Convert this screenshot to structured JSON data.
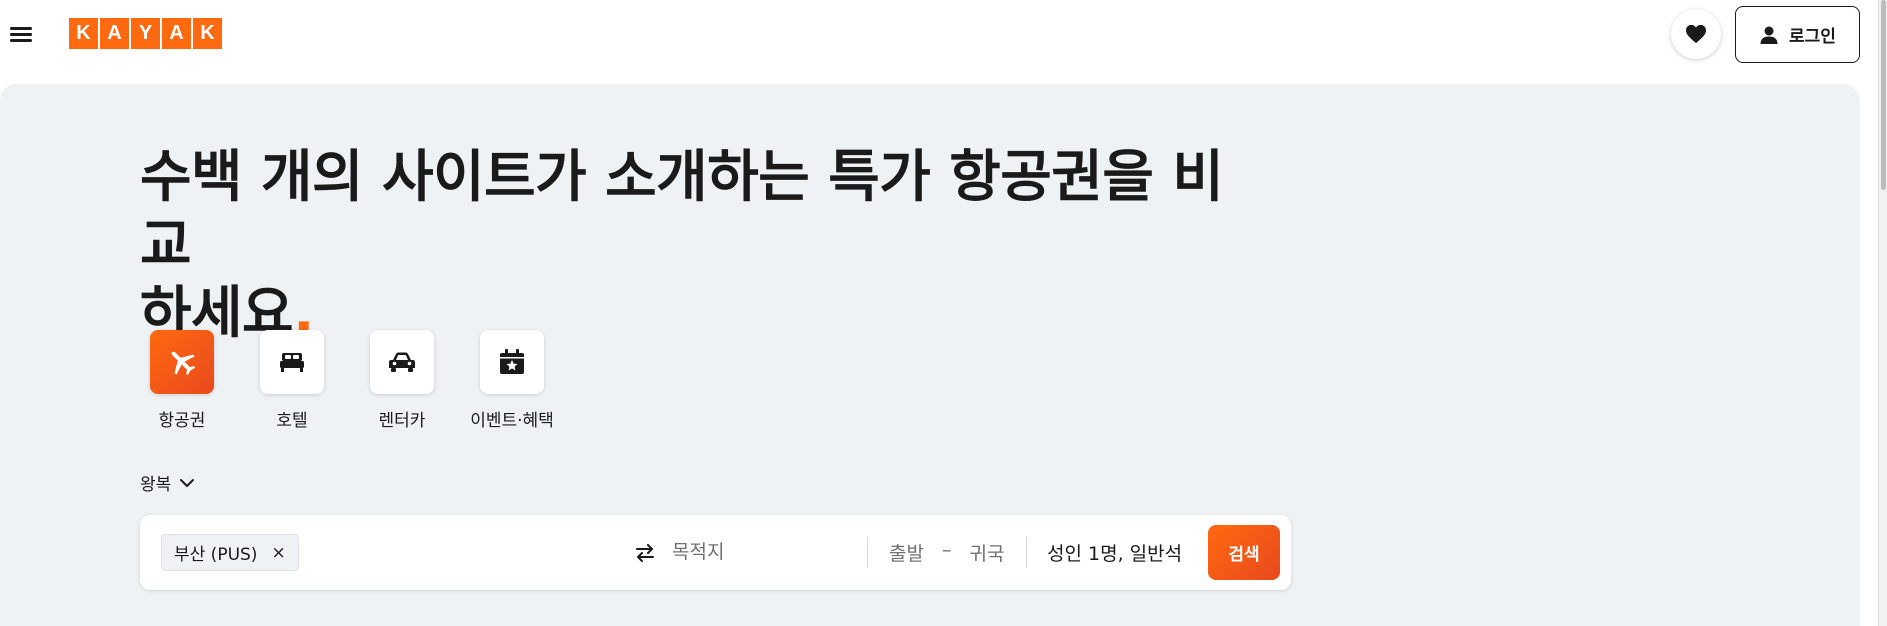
{
  "header": {
    "logo_letters": [
      "K",
      "A",
      "Y",
      "A",
      "K"
    ],
    "login_label": "로그인"
  },
  "hero": {
    "headline_line1": "수백 개의 사이트가 소개하는 특가 항공권을 비교",
    "headline_line2": "하세요",
    "headline_dot": "."
  },
  "verticals": [
    {
      "label": "항공권",
      "icon": "plane-icon",
      "active": true
    },
    {
      "label": "호텔",
      "icon": "bed-icon",
      "active": false
    },
    {
      "label": "렌터카",
      "icon": "car-icon",
      "active": false
    },
    {
      "label": "이벤트·혜택",
      "icon": "calendar-star-icon",
      "active": false
    }
  ],
  "trip_type": {
    "value": "왕복"
  },
  "search": {
    "origin_chip": "부산 (PUS)",
    "origin_remove": "×",
    "destination_placeholder": "목적지",
    "depart_label": "출발",
    "date_separator": "–",
    "return_label": "귀국",
    "travelers": "성인 1명, 일반석",
    "search_label": "검색"
  },
  "colors": {
    "accent": "#ff690f",
    "panel_bg": "#eff2f5"
  }
}
